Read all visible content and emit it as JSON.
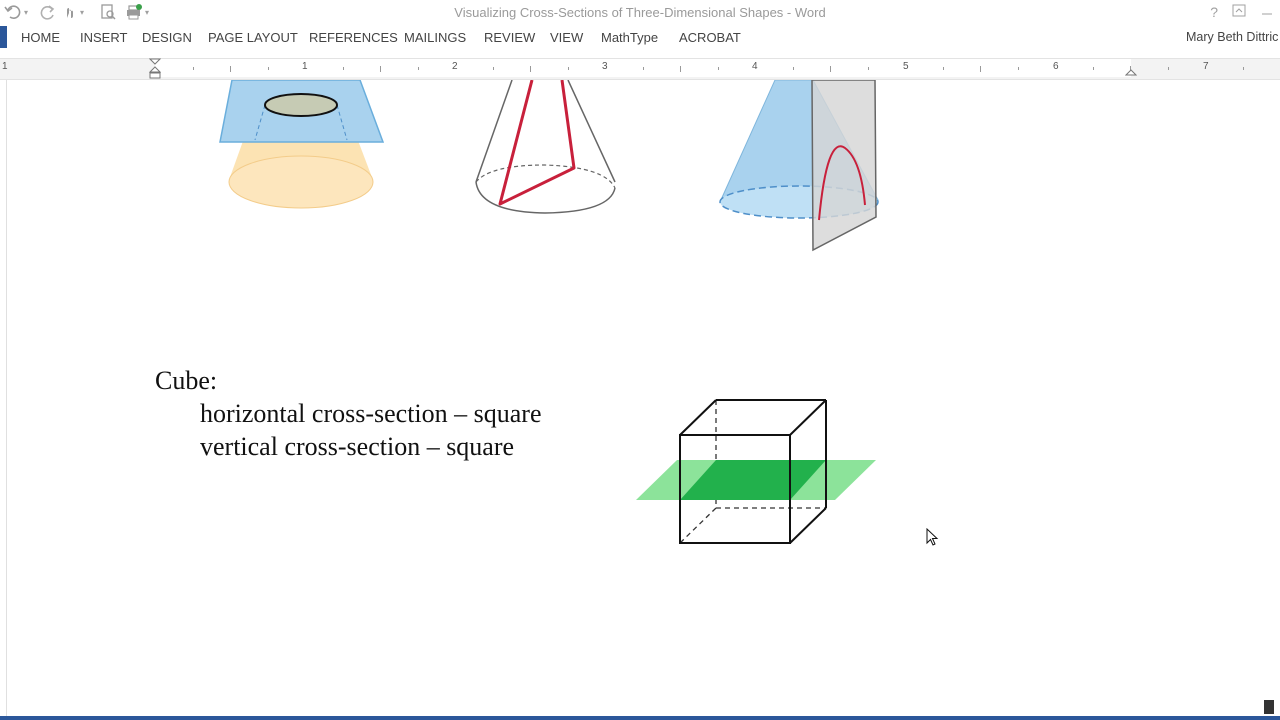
{
  "window": {
    "title": "Visualizing Cross-Sections of Three-Dimensional Shapes - Word",
    "help": "?",
    "user": "Mary Beth Dittric"
  },
  "ribbon": {
    "tabs": [
      "HOME",
      "INSERT",
      "DESIGN",
      "PAGE LAYOUT",
      "REFERENCES",
      "MAILINGS",
      "REVIEW",
      "VIEW",
      "MathType",
      "ACROBAT"
    ]
  },
  "ruler": {
    "numbers": [
      "1",
      "1",
      "2",
      "3",
      "4",
      "5",
      "6",
      "7"
    ]
  },
  "document": {
    "heading": "Cube:",
    "lines": [
      "horizontal cross-section – square",
      "vertical cross-section – square"
    ]
  },
  "colors": {
    "accent": "#2b579a",
    "cross_section_fill": "#22b14c",
    "plane_fill": "#7fe08f",
    "cone_blue": "#a9d2ee",
    "cone_orange": "#fbd99a",
    "cone_edge_red": "#c8203b"
  }
}
